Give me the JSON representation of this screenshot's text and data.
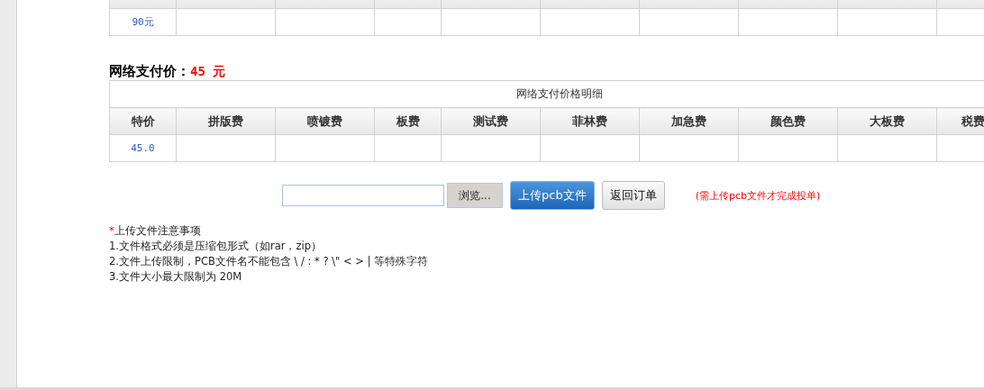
{
  "top_table": {
    "rows": [
      {
        "cells": [
          "90元"
        ]
      }
    ]
  },
  "online_price": {
    "label": "网络支付价：",
    "amount": "45 元"
  },
  "price_table": {
    "caption": "网络支付价格明细",
    "columns": [
      "特价",
      "拼版费",
      "喷镀费",
      "板费",
      "测试费",
      "菲林费",
      "加急费",
      "颜色费",
      "大板费",
      "税费"
    ],
    "rows": [
      {
        "cells": [
          "45.0"
        ]
      }
    ]
  },
  "upload": {
    "browse": "浏览...",
    "upload_button": "上传pcb文件",
    "back_button": "返回订单",
    "hint": "(需上传pcb文件才完成投单)"
  },
  "notes": {
    "mark": "*",
    "title": "上传文件注意事项",
    "items": [
      "1.文件格式必须是压缩包形式（如rar，zip）",
      "2.文件上传限制，PCB文件名不能包含 \\ / : * ? \\\" < > | 等特殊字符",
      "3.文件大小最大限制为 20M"
    ]
  }
}
